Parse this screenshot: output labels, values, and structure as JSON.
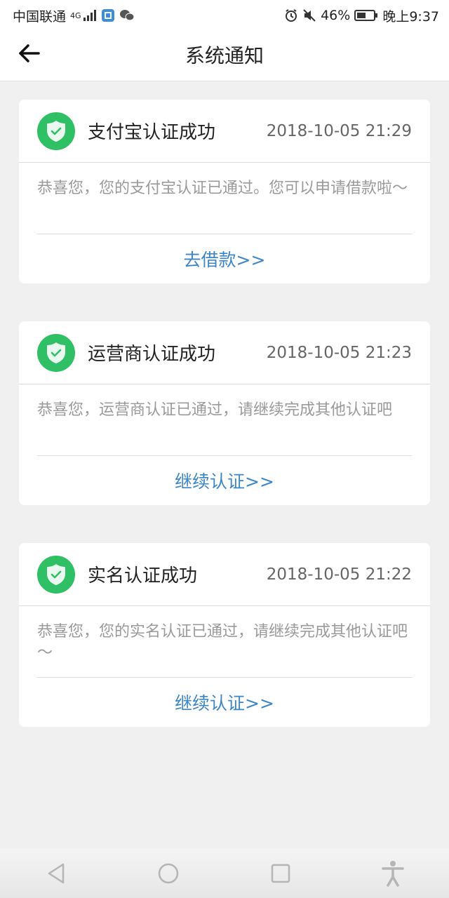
{
  "status_bar": {
    "carrier": "中国联通",
    "network_type": "4G",
    "battery_percent": "46%",
    "time": "晚上9:37",
    "icons": [
      "signal-icon",
      "app-notification-icon",
      "wechat-icon",
      "alarm-icon",
      "mute-icon",
      "battery-icon"
    ]
  },
  "header": {
    "title": "系统通知",
    "back_icon": "back-arrow-icon"
  },
  "notifications": [
    {
      "title": "支付宝认证成功",
      "time": "2018-10-05 21:29",
      "message": "恭喜您，您的支付宝认证已通过。您可以申请借款啦～",
      "action": "去借款>>"
    },
    {
      "title": "运营商认证成功",
      "time": "2018-10-05 21:23",
      "message": "恭喜您，运营商认证已通过，请继续完成其他认证吧",
      "action": "继续认证>>"
    },
    {
      "title": "实名认证成功",
      "time": "2018-10-05 21:22",
      "message": "恭喜您，您的实名认证已通过，请继续完成其他认证吧～",
      "action": "继续认证>>"
    }
  ],
  "nav_bar": {
    "icons": [
      "back-triangle-icon",
      "home-circle-icon",
      "recents-square-icon",
      "accessibility-icon"
    ]
  },
  "colors": {
    "accent": "#3d86c6",
    "badge": "#2fbf65",
    "background": "#f0f0f0"
  }
}
